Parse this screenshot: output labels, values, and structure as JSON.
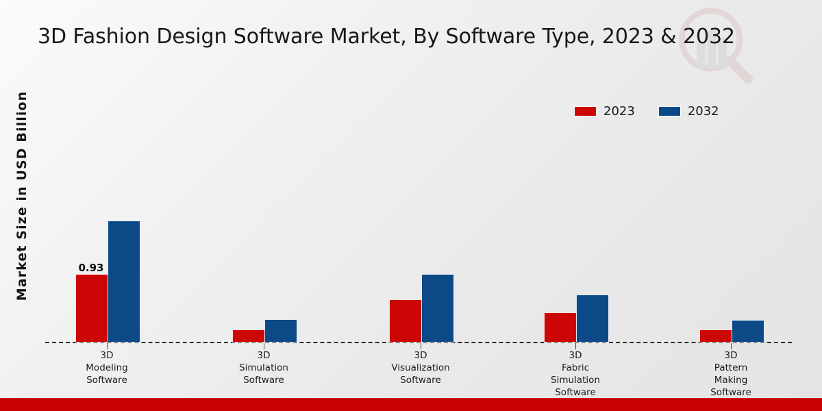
{
  "chart_data": {
    "type": "bar",
    "title": "3D Fashion Design Software Market, By Software Type, 2023 & 2032",
    "xlabel": "",
    "ylabel": "Market Size in USD Billion",
    "categories": [
      "3D\nModeling\nSoftware",
      "3D\nSimulation\nSoftware",
      "3D\nVisualization\nSoftware",
      "3D\nFabric\nSimulation\nSoftware",
      "3D\nPattern\nMaking\nSoftware"
    ],
    "series": [
      {
        "name": "2023",
        "color": "#cc0505",
        "values": [
          0.93,
          0.16,
          0.58,
          0.4,
          0.16
        ]
      },
      {
        "name": "2032",
        "color": "#0b4a87",
        "values": [
          1.67,
          0.3,
          0.93,
          0.65,
          0.29
        ]
      }
    ],
    "data_labels": [
      {
        "series": "2023",
        "category_index": 0,
        "text": "0.93"
      }
    ],
    "ylim": [
      0,
      1.9
    ],
    "grid": false,
    "legend_position": "top-right",
    "baseline_style": "dashed"
  },
  "legend": {
    "items": [
      {
        "label": "2023",
        "color": "#cc0505"
      },
      {
        "label": "2032",
        "color": "#0b4a87"
      }
    ]
  },
  "footer": {
    "color": "#c80000"
  },
  "watermark": {
    "name": "magnifier-bar-chart-logo"
  }
}
